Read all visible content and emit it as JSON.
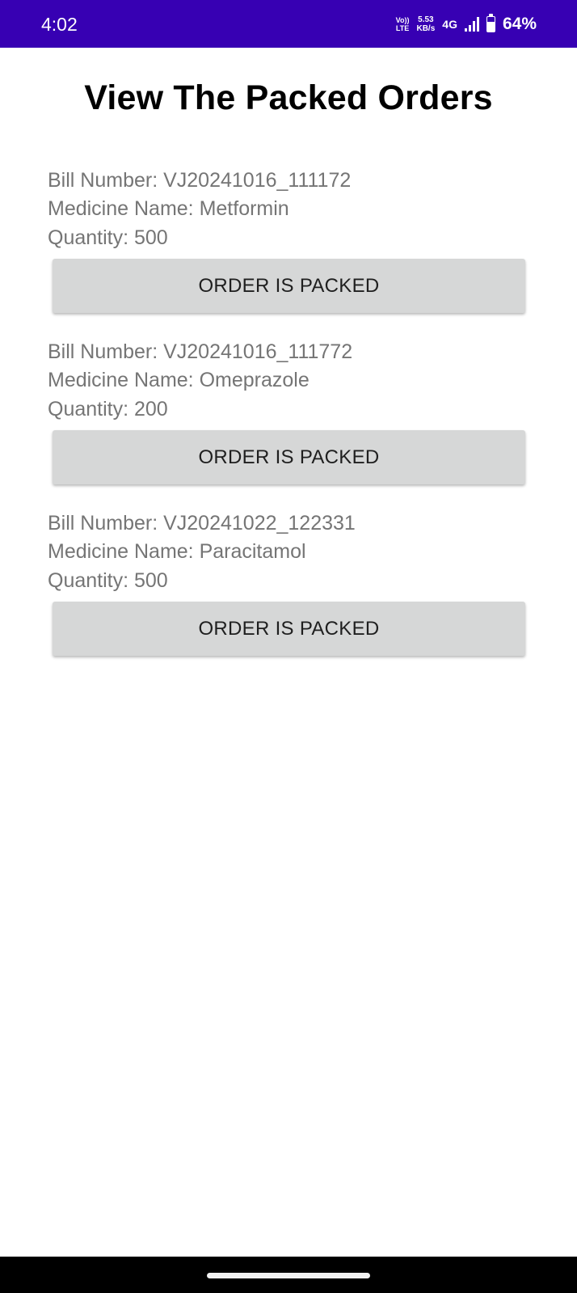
{
  "status_bar": {
    "time": "4:02",
    "volte_top": "Vo))",
    "volte_bottom": "LTE",
    "net_speed_value": "5.53",
    "net_speed_unit": "KB/s",
    "network_type": "4G",
    "battery_percent": "64%",
    "battery_level": 0.64,
    "background_color": "#3700b3"
  },
  "page": {
    "title": "View The Packed Orders"
  },
  "orders": [
    {
      "bill": "Bill Number: VJ20241016_111172",
      "medicine": "Medicine Name: Metformin",
      "quantity": "Quantity: 500",
      "button_label": "ORDER IS PACKED"
    },
    {
      "bill": "Bill Number: VJ20241016_111772",
      "medicine": "Medicine Name: Omeprazole",
      "quantity": "Quantity: 200",
      "button_label": "ORDER IS PACKED"
    },
    {
      "bill": "Bill Number: VJ20241022_122331",
      "medicine": "Medicine Name: Paracitamol",
      "quantity": "Quantity: 500",
      "button_label": "ORDER IS PACKED"
    }
  ],
  "colors": {
    "button_bg": "#d6d7d7",
    "detail_text": "#757575"
  }
}
